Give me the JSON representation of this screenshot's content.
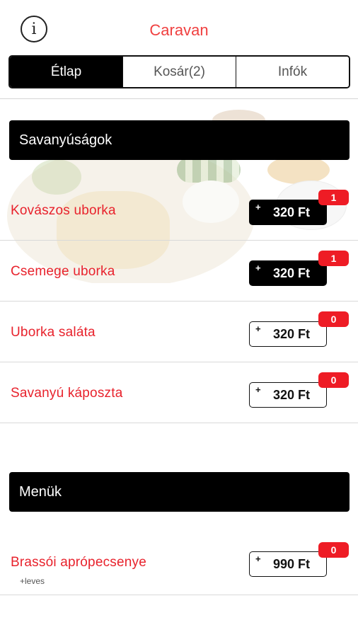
{
  "header": {
    "title": "Caravan",
    "info_icon": "info-icon",
    "info_glyph": "i"
  },
  "tabs": [
    {
      "label": "Étlap",
      "active": true
    },
    {
      "label": "Kosár(2)",
      "active": false
    },
    {
      "label": "Infók",
      "active": false
    }
  ],
  "sections": [
    {
      "title": "Savanyúságok",
      "items": [
        {
          "name": "Kovászos uborka",
          "price": "320 Ft",
          "count": "1",
          "in_cart": true
        },
        {
          "name": "Csemege uborka",
          "price": "320 Ft",
          "count": "1",
          "in_cart": true
        },
        {
          "name": "Uborka saláta",
          "price": "320 Ft",
          "count": "0",
          "in_cart": false
        },
        {
          "name": "Savanyú káposzta",
          "price": "320 Ft",
          "count": "0",
          "in_cart": false
        }
      ]
    },
    {
      "title": "Menük",
      "items": [
        {
          "name": "Brassói aprópecsenye",
          "subtitle": "+leves",
          "price": "990 Ft",
          "count": "0",
          "in_cart": false
        }
      ]
    }
  ],
  "price_button_plus": "+",
  "colors": {
    "accent": "#e8222c",
    "title": "#f04040",
    "badge": "#ee1c25",
    "header_bg": "#000000"
  }
}
